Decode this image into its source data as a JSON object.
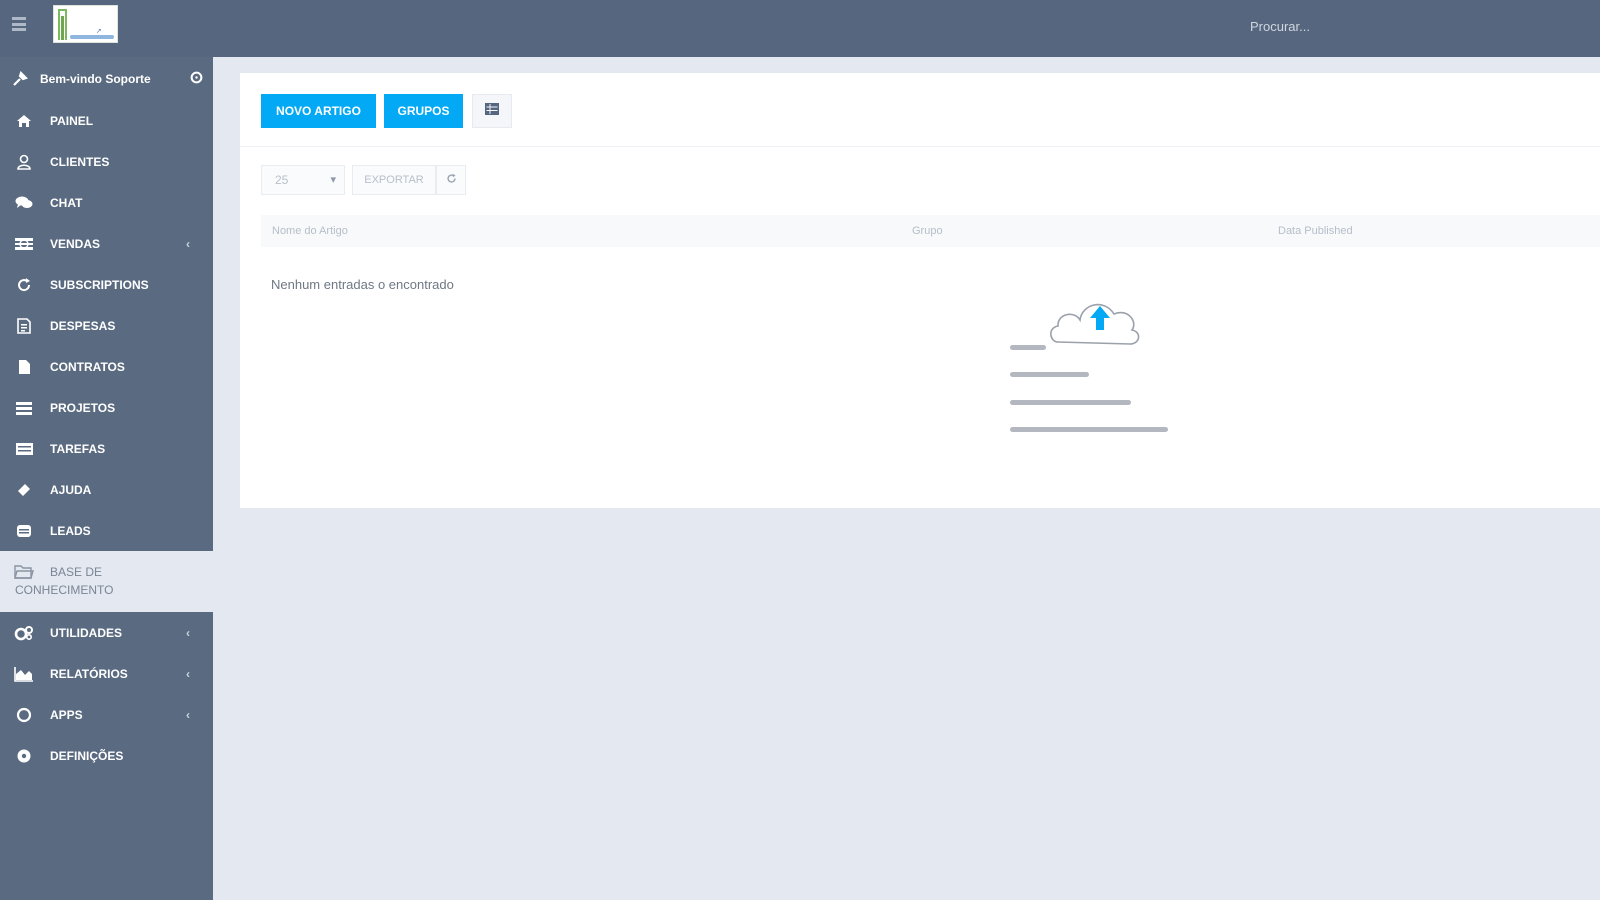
{
  "header": {
    "search_placeholder": "Procurar..."
  },
  "sidebar": {
    "welcome_text": "Bem-vindo Soporte",
    "items": [
      {
        "label": "PAINEL",
        "icon": "home-icon"
      },
      {
        "label": "CLIENTES",
        "icon": "user-icon"
      },
      {
        "label": "CHAT",
        "icon": "chat-icon"
      },
      {
        "label": "VENDAS",
        "icon": "balance-icon",
        "has_submenu": true
      },
      {
        "label": "SUBSCRIPTIONS",
        "icon": "refresh-icon"
      },
      {
        "label": "DESPESAS",
        "icon": "receipt-icon"
      },
      {
        "label": "CONTRATOS",
        "icon": "file-icon"
      },
      {
        "label": "PROJETOS",
        "icon": "bars-icon"
      },
      {
        "label": "TAREFAS",
        "icon": "tasks-icon"
      },
      {
        "label": "AJUDA",
        "icon": "ticket-icon"
      },
      {
        "label": "LEADS",
        "icon": "tty-icon"
      },
      {
        "label": "BASE DE CONHECIMENTO",
        "label_line1": "BASE DE",
        "label_line2": "CONHECIMENTO",
        "icon": "folder-open-icon",
        "active": true
      },
      {
        "label": "UTILIDADES",
        "icon": "cogs-icon",
        "has_submenu": true
      },
      {
        "label": "RELATÓRIOS",
        "icon": "area-chart-icon",
        "has_submenu": true
      },
      {
        "label": "APPS",
        "icon": "circle-icon",
        "has_submenu": true
      },
      {
        "label": "DEFINIÇÕES",
        "icon": "gear-icon"
      }
    ]
  },
  "toolbar": {
    "new_article_label": "NOVO ARTIGO",
    "groups_label": "GRUPOS"
  },
  "table_controls": {
    "page_length": "25",
    "export_label": "EXPORTAR"
  },
  "table": {
    "columns": [
      "Nome do Artigo",
      "Grupo",
      "Data Published"
    ],
    "rows": [],
    "empty_text": "Nenhum entradas o encontrado"
  },
  "colors": {
    "topbar": "#56667e",
    "sidebar": "#5a6a80",
    "accent": "#03a9f4",
    "page_bg": "#e4e8f0"
  }
}
